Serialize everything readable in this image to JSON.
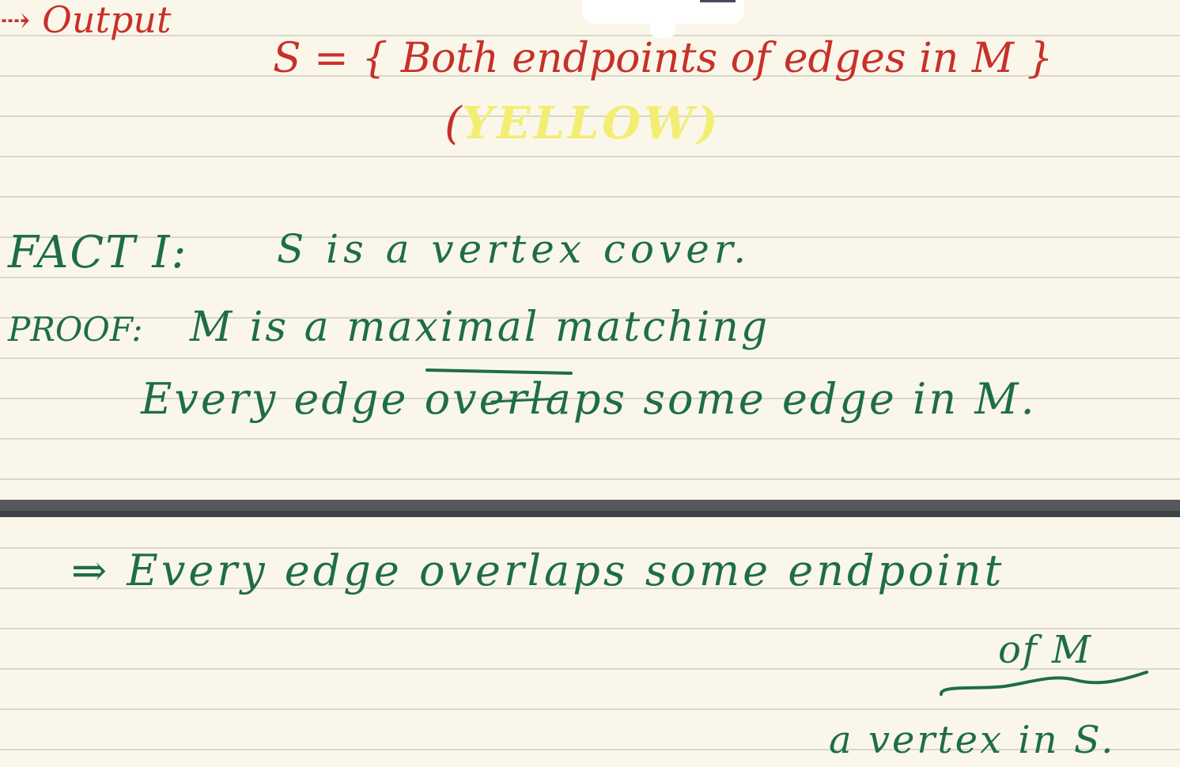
{
  "note": {
    "output_heading": "⇢ Output",
    "set_definition": "S = { Both endpoints of edges in M }",
    "yellow_label": "YELLOW",
    "yellow_open_paren": "(",
    "yellow_close_paren": ")",
    "fact_label": "FACT I:",
    "fact_text": "S is a vertex cover.",
    "proof_label": "PROOF:",
    "proof_line1": "M is a maximal matching",
    "proof_line2": "Every edge overlaps some edge in M.",
    "implies_line": "⇒ Every edge overlaps some endpoint",
    "of_m": "of M",
    "vertex_in_s": "a vertex in S."
  },
  "colors": {
    "paper": "#faf7ea",
    "rule": "#d9d7cc",
    "red_ink": "#c8302a",
    "green_ink": "#1e6d4a",
    "yellow_ink": "#f2ee74",
    "divider": "#56595c"
  }
}
